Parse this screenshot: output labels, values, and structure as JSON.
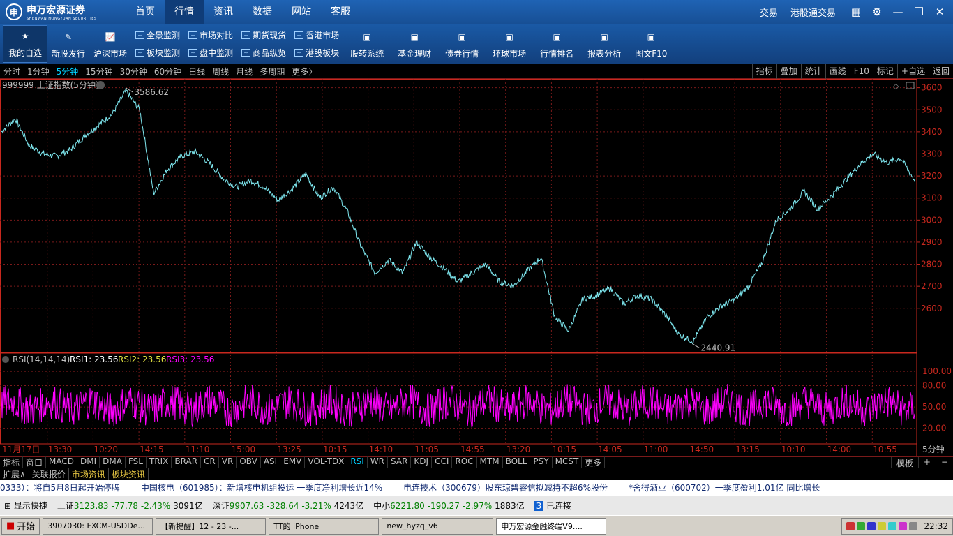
{
  "app": {
    "logo_text": "申万宏源证券",
    "logo_sub": "SHENWAN HONGYUAN SECURITIES"
  },
  "nav": [
    "首页",
    "行情",
    "资讯",
    "数据",
    "网站",
    "客服"
  ],
  "nav_active": 1,
  "top_right": {
    "trade": "交易",
    "hk_trade": "港股通交易"
  },
  "toolbar": {
    "big": [
      "我的自选",
      "新股发行",
      "沪深市场"
    ],
    "small_left": [
      [
        "全景监测",
        "板块监测"
      ],
      [
        "市场对比",
        "盘中监测"
      ],
      [
        "期货现货",
        "商品纵览"
      ],
      [
        "香港市场",
        "港股板块"
      ]
    ],
    "big_right": [
      "股转系统",
      "基金理财",
      "债券行情",
      "环球市场",
      "行情排名",
      "报表分析",
      "图文F10"
    ]
  },
  "periods": [
    "分时",
    "1分钟",
    "5分钟",
    "15分钟",
    "30分钟",
    "60分钟",
    "日线",
    "周线",
    "月线",
    "多周期",
    "更多〉"
  ],
  "period_active": 2,
  "period_right": [
    "指标",
    "叠加",
    "统计",
    "画线",
    "F10",
    "标记",
    "+自选",
    "返回"
  ],
  "main_chart": {
    "title": "999999 上证指数(5分钟)",
    "high_label": "3586.62",
    "low_label": "2440.91"
  },
  "rsi": {
    "title": "RSI(14,14,14)",
    "rsi1": "RSI1: 23.56",
    "rsi2": "RSI2: 23.56",
    "rsi3": "RSI3: 23.56"
  },
  "chart_data": [
    {
      "type": "line",
      "title": "999999 上证指数(5分钟)",
      "ylim": [
        2400,
        3640
      ],
      "yticks": [
        3600,
        3500,
        3400,
        3300,
        3200,
        3100,
        3000,
        2900,
        2800,
        2700,
        2600
      ],
      "annotations": [
        "3586.62",
        "2440.91"
      ],
      "series": [
        {
          "values": [
            3400,
            3460,
            3340,
            3300,
            3290,
            3320,
            3380,
            3430,
            3480,
            3586,
            3500,
            3120,
            3230,
            3290,
            3310,
            3260,
            3190,
            3150,
            3180,
            3150,
            3090,
            3140,
            3210,
            3100,
            3150,
            3040,
            2880,
            2760,
            2820,
            2760,
            2900,
            2830,
            2780,
            2720,
            2760,
            2800,
            2720,
            2700,
            2770,
            2830,
            2560,
            2500,
            2640,
            2660,
            2690,
            2620,
            2660,
            2640,
            2570,
            2480,
            2450,
            2560,
            2610,
            2640,
            2700,
            2810,
            3000,
            3050,
            3130,
            3050,
            3110,
            3180,
            3250,
            3300,
            3260,
            3280,
            3180
          ]
        }
      ]
    },
    {
      "type": "line",
      "title": "RSI(14,14,14)",
      "ylim": [
        0,
        110
      ],
      "yticks": [
        100.0,
        80.0,
        50.0,
        20.0
      ],
      "series": [
        {
          "name": "RSI1: 23.56",
          "values": []
        }
      ]
    }
  ],
  "x_labels": [
    "11月17日",
    "13:30",
    "10:20",
    "14:15",
    "11:10",
    "15:00",
    "13:25",
    "10:15",
    "14:10",
    "11:05",
    "14:55",
    "13:20",
    "10:15",
    "14:05",
    "11:00",
    "14:50",
    "13:15",
    "10:10",
    "14:00",
    "10:55"
  ],
  "x_period": "5分钟",
  "indicators": [
    "指标",
    "窗口",
    "MACD",
    "DMI",
    "DMA",
    "FSL",
    "TRIX",
    "BRAR",
    "CR",
    "VR",
    "OBV",
    "ASI",
    "EMV",
    "VOL-TDX",
    "RSI",
    "WR",
    "SAR",
    "KDJ",
    "CCI",
    "ROC",
    "MTM",
    "BOLL",
    "PSY",
    "MCST",
    "更多"
  ],
  "indicator_active": 14,
  "ind_right": [
    "模板",
    "+",
    "−"
  ],
  "info_tabs": [
    "扩展∧",
    "关联报价",
    "市场资讯",
    "板块资讯"
  ],
  "ticker": [
    "0333）：将自5月8日起开始停牌",
    "中国核电（601985）：新增核电机组投运  一季度净利增长近14%",
    "电连技术（300679）股东琼碧睿信拟减持不超6%股份",
    "*舍得酒业（600702）一季度盈利1.01亿  同比增长"
  ],
  "status": {
    "show": "显示快捷",
    "sh_label": "上证",
    "sh_val": "3123.83",
    "sh_chg": "-77.78",
    "sh_pct": "-2.43%",
    "sh_amt": "3091亿",
    "sz_label": "深证",
    "sz_val": "9907.63",
    "sz_chg": "-328.64",
    "sz_pct": "-3.21%",
    "sz_amt": "4243亿",
    "zx_label": "中小",
    "zx_val": "6221.80",
    "zx_chg": "-190.27",
    "zx_pct": "-2.97%",
    "zx_amt": "1883亿",
    "conn_num": "3",
    "conn": "已连接"
  },
  "taskbar": {
    "start": "开始",
    "items": [
      "3907030: FXCM-USDDe...",
      "【新提醒】12 - 23 -...",
      "TT的 iPhone",
      "new_hyzq_v6",
      "申万宏源金融终端V9...."
    ],
    "active": 4,
    "clock": "22:32"
  },
  "colors": {
    "price": "#7fe8f0",
    "rsi": "#ff00ff",
    "grid": "#7a1a1a",
    "axis": "#c8281e"
  }
}
